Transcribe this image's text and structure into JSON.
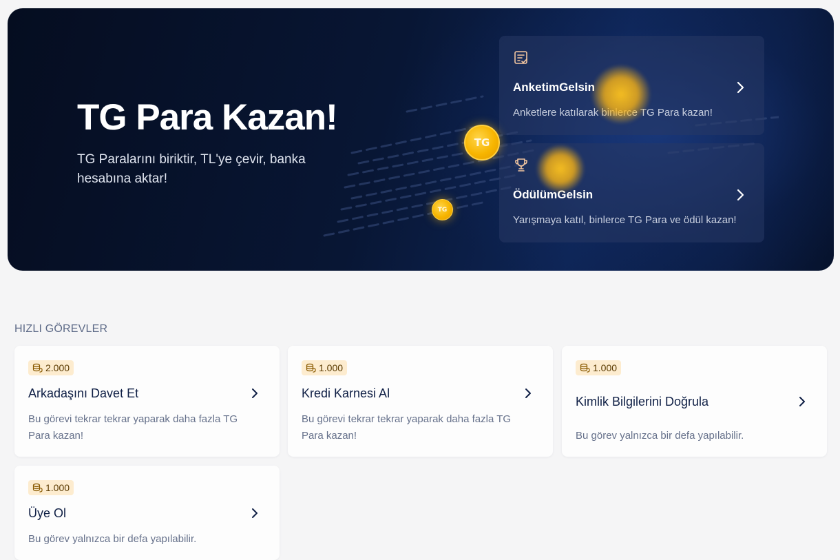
{
  "hero": {
    "title": "TG Para Kazan!",
    "subtitle": "TG Paralarını biriktir, TL'ye çevir, banka hesabına aktar!",
    "coin_label": "TG",
    "cards": [
      {
        "icon": "survey-icon",
        "title": "AnketimGelsin",
        "description": "Anketlere katılarak binlerce TG Para kazan!"
      },
      {
        "icon": "trophy-icon",
        "title": "ÖdülümGelsin",
        "description": "Yarışmaya katıl, binlerce TG Para ve ödül kazan!"
      }
    ]
  },
  "quick_tasks": {
    "section_title": "HIZLI GÖREVLER",
    "items": [
      {
        "reward": "2.000",
        "title": "Arkadaşını Davet Et",
        "description": "Bu görevi tekrar tekrar yaparak daha fazla TG Para kazan!"
      },
      {
        "reward": "1.000",
        "title": "Kredi Karnesi Al",
        "description": "Bu görevi tekrar tekrar yaparak daha fazla TG Para kazan!"
      },
      {
        "reward": "1.000",
        "title": "Kimlik Bilgilerini Doğrula",
        "description": "Bu görev yalnızca bir defa yapılabilir."
      },
      {
        "reward": "1.000",
        "title": "Üye Ol",
        "description": "Bu görev yalnızca bir defa yapılabilir."
      }
    ]
  },
  "colors": {
    "hero_bg": "#081634",
    "badge_bg": "#fdeccf",
    "coin": "#f7b500",
    "title_text": "#0f1f45"
  }
}
